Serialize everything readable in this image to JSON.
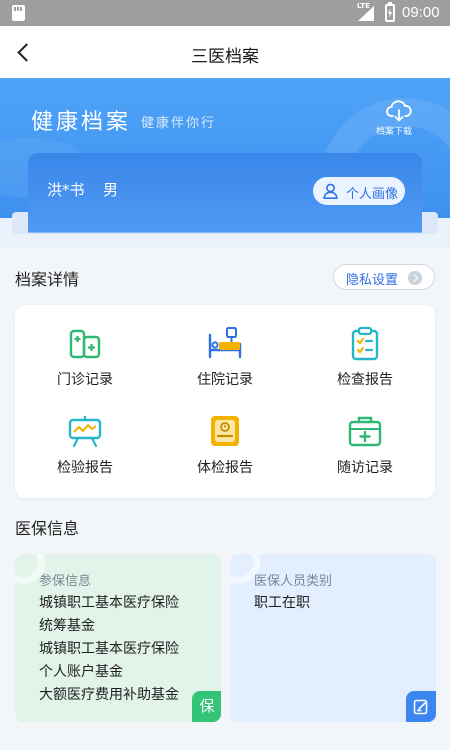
{
  "status_bar": {
    "network": "LTE",
    "time": "09:00"
  },
  "nav": {
    "title": "三医档案"
  },
  "hero": {
    "title": "健康档案",
    "subtitle": "健康伴你行",
    "download_label": "档案下载",
    "user_name": "洪*书",
    "user_gender": "男",
    "profile_button": "个人画像"
  },
  "records": {
    "section_title": "档案详情",
    "privacy_button": "隐私设置",
    "items": [
      {
        "label": "门诊记录",
        "icon": "clinic-icon"
      },
      {
        "label": "住院记录",
        "icon": "hospital-bed-icon"
      },
      {
        "label": "检查报告",
        "icon": "clipboard-check-icon"
      },
      {
        "label": "检验报告",
        "icon": "lab-report-icon"
      },
      {
        "label": "体检报告",
        "icon": "physical-exam-icon"
      },
      {
        "label": "随访记录",
        "icon": "medical-kit-icon"
      }
    ]
  },
  "insurance": {
    "section_title": "医保信息",
    "left_card": {
      "heading": "参保信息",
      "lines": [
        "城镇职工基本医疗保险",
        "统筹基金",
        "城镇职工基本医疗保险",
        "个人账户基金",
        "大额医疗费用补助基金"
      ],
      "badge": "保"
    },
    "right_card": {
      "heading": "医保人员类别",
      "lines": [
        "职工在职"
      ]
    }
  },
  "colors": {
    "hero_blue": "#3b8def",
    "accent_blue": "#2f6fe4",
    "icon_green": "#2fb874",
    "icon_blue": "#2f6fe4",
    "icon_teal": "#26b6c9",
    "icon_yellow": "#f3b200"
  }
}
